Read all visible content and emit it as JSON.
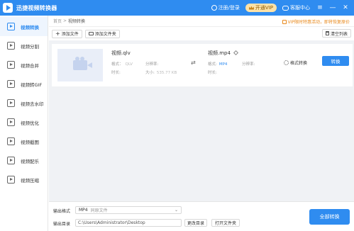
{
  "app": {
    "title": "迅捷视频转换器",
    "login": "注册/登录",
    "vip": "开通VIP",
    "help": "客服中心",
    "minimize": "—",
    "close": "✕"
  },
  "sidebar": {
    "items": [
      {
        "label": "视频转换",
        "icon": "video-convert-icon"
      },
      {
        "label": "视频分割",
        "icon": "video-split-icon"
      },
      {
        "label": "视频合并",
        "icon": "video-merge-icon"
      },
      {
        "label": "视频转GIF",
        "icon": "video-gif-icon"
      },
      {
        "label": "视频去水印",
        "icon": "watermark-remove-icon"
      },
      {
        "label": "视频优化",
        "icon": "video-optimize-icon"
      },
      {
        "label": "视频截图",
        "icon": "video-screenshot-icon"
      },
      {
        "label": "视频配乐",
        "icon": "video-music-icon"
      },
      {
        "label": "视频压缩",
        "icon": "video-compress-icon"
      }
    ]
  },
  "breadcrumb": {
    "home": "首页",
    "sep": ">",
    "current": "视频转换"
  },
  "notice": "VIP限时特惠活动，即将恢复原价",
  "toolbar": {
    "add_file": "添加文件",
    "add_folder": "添加文件夹",
    "clear_list": "清空列表"
  },
  "file": {
    "source": {
      "name": "视频.qlv",
      "format_label": "格式：",
      "format": "QLV",
      "resolution_label": "分辨率:",
      "resolution": "",
      "duration_label": "时长:",
      "duration": "",
      "size_label": "大小:",
      "size": "535.77 KB"
    },
    "target": {
      "name": "视频.mp4",
      "format_label": "格式:",
      "format": "MP4",
      "resolution_label": "分辨率:",
      "resolution": "",
      "duration_label": "时长:",
      "duration": ""
    },
    "settings_label": "格式转换",
    "convert_label": "转换"
  },
  "bottom": {
    "output_format_label": "输出格式",
    "output_format": "MP4",
    "output_quality": "同原文件",
    "output_dir_label": "输出目录",
    "output_dir": "C:\\Users\\Administrator\\Desktop",
    "change_dir": "更改目录",
    "open_folder": "打开文件夹",
    "convert_all": "全部转换"
  },
  "colors": {
    "accent": "#2f8cf0",
    "notice": "#e8891c",
    "vip_bg": "#fde2a8"
  }
}
